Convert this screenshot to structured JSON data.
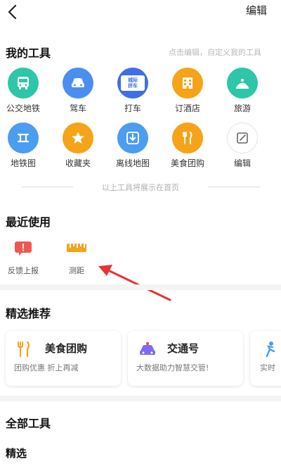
{
  "topbar": {
    "edit_label": "编辑"
  },
  "my_tools": {
    "title": "我的工具",
    "hint": "点击编辑，自定义我的工具",
    "items": [
      {
        "label": "公交地铁",
        "icon": "bus-icon",
        "color": "#2dc6a8"
      },
      {
        "label": "驾车",
        "icon": "car-icon",
        "color": "#4a8ff0"
      },
      {
        "label": "打车",
        "icon": "taxi-icon",
        "color": "#3f6fe6"
      },
      {
        "label": "订酒店",
        "icon": "hotel-icon",
        "color": "#f5a318"
      },
      {
        "label": "旅游",
        "icon": "travel-icon",
        "color": "#2dc6a8"
      },
      {
        "label": "地铁图",
        "icon": "metro-map-icon",
        "color": "#4a9df0"
      },
      {
        "label": "收藏夹",
        "icon": "star-icon",
        "color": "#f5a318"
      },
      {
        "label": "离线地图",
        "icon": "download-icon",
        "color": "#4a9df0"
      },
      {
        "label": "美食团购",
        "icon": "food-icon",
        "color": "#f5a318"
      },
      {
        "label": "编辑",
        "icon": "edit-icon",
        "color": "#ffffff"
      }
    ],
    "taxi_badge": "城际拼车"
  },
  "divider_text": "以上工具将展示在首页",
  "recent": {
    "title": "最近使用",
    "items": [
      {
        "label": "反馈上报",
        "icon": "feedback-icon",
        "color": "#f2574f"
      },
      {
        "label": "测距",
        "icon": "ruler-icon",
        "color": "#f5a318"
      }
    ]
  },
  "featured": {
    "title": "精选推荐",
    "cards": [
      {
        "title": "美食团购",
        "desc": "团购优惠 折上再减",
        "icon": "food-icon"
      },
      {
        "title": "交通号",
        "desc": "大数据助力智慧交管!",
        "icon": "police-car-icon"
      },
      {
        "title": "",
        "desc": "实时",
        "icon": "person-icon"
      }
    ]
  },
  "all_tools": {
    "title": "全部工具",
    "subtitle": "精选"
  },
  "colors": {
    "accent_orange": "#f5a318",
    "teal": "#2dc6a8",
    "blue": "#4a8ff0",
    "red_arrow": "#e8332f"
  }
}
